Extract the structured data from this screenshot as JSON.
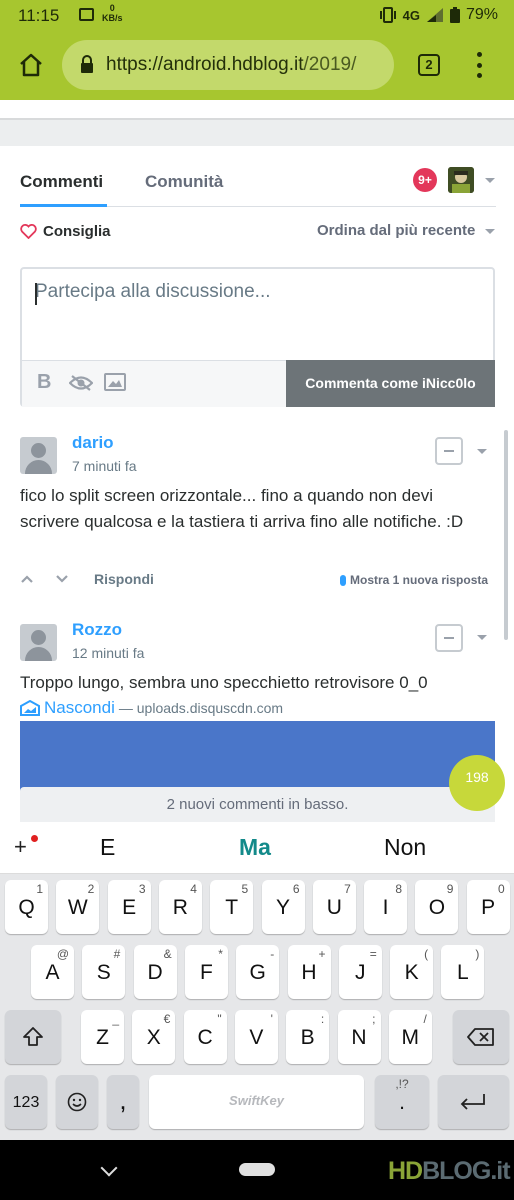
{
  "status_bar": {
    "time": "11:15",
    "net_speed_value": "0",
    "net_speed_unit": "KB/s",
    "network": "4G",
    "battery": "79%"
  },
  "browser": {
    "url_main": "https://android.hdblog.it",
    "url_rest": "/2019/",
    "tab_count": "2",
    "colors": {
      "toolbar": "#a7c62f"
    }
  },
  "disqus": {
    "tabs": [
      "Commenti",
      "Comunità"
    ],
    "notifications": "9+",
    "recommend_label": "Consiglia",
    "sort_label": "Ordina dal più recente",
    "composer": {
      "placeholder": "Partecipa alla discussione...",
      "submit_label": "Commenta come iNicc0lo"
    },
    "comments": [
      {
        "author": "dario",
        "time": "7 minuti fa",
        "text": "fico lo split screen orizzontale... fino a quando non devi scrivere qualcosa e la tastiera ti arriva fino alle notifiche. :D",
        "reply_label": "Rispondi",
        "new_reply_label": "Mostra 1 nuova risposta"
      },
      {
        "author": "Rozzo",
        "time": "12 minuti fa",
        "text": "Troppo lungo, sembra uno specchietto retrovisore 0_0",
        "hide_label": "Nascondi",
        "source": "— uploads.disquscdn.com"
      }
    ],
    "comment_count": "198",
    "new_comments_banner": "2 nuovi commenti in basso.",
    "accent_color": "#2e9fff"
  },
  "keyboard": {
    "suggestions": [
      "E",
      "Ma",
      "Non"
    ],
    "row1": [
      {
        "key": "Q",
        "sub": "1"
      },
      {
        "key": "W",
        "sub": "2"
      },
      {
        "key": "E",
        "sub": "3"
      },
      {
        "key": "R",
        "sub": "4"
      },
      {
        "key": "T",
        "sub": "5"
      },
      {
        "key": "Y",
        "sub": "6"
      },
      {
        "key": "U",
        "sub": "7"
      },
      {
        "key": "I",
        "sub": "8"
      },
      {
        "key": "O",
        "sub": "9"
      },
      {
        "key": "P",
        "sub": "0"
      }
    ],
    "row2": [
      {
        "key": "A",
        "sub": "@"
      },
      {
        "key": "S",
        "sub": "#"
      },
      {
        "key": "D",
        "sub": "&"
      },
      {
        "key": "F",
        "sub": "*"
      },
      {
        "key": "G",
        "sub": "-"
      },
      {
        "key": "H",
        "sub": "+"
      },
      {
        "key": "J",
        "sub": "="
      },
      {
        "key": "K",
        "sub": "("
      },
      {
        "key": "L",
        "sub": ")"
      }
    ],
    "row3": [
      {
        "key": "Z",
        "sub": "_"
      },
      {
        "key": "X",
        "sub": "€"
      },
      {
        "key": "C",
        "sub": "\""
      },
      {
        "key": "V",
        "sub": "'"
      },
      {
        "key": "B",
        "sub": ":"
      },
      {
        "key": "N",
        "sub": ";"
      },
      {
        "key": "M",
        "sub": "/"
      }
    ],
    "numbers_key": "123",
    "comma_key": ",",
    "period_key": ".",
    "period_sub": ",!?",
    "brand": "SwiftKey"
  },
  "watermark": {
    "hd": "HD",
    "blog": "BLOG.it"
  }
}
